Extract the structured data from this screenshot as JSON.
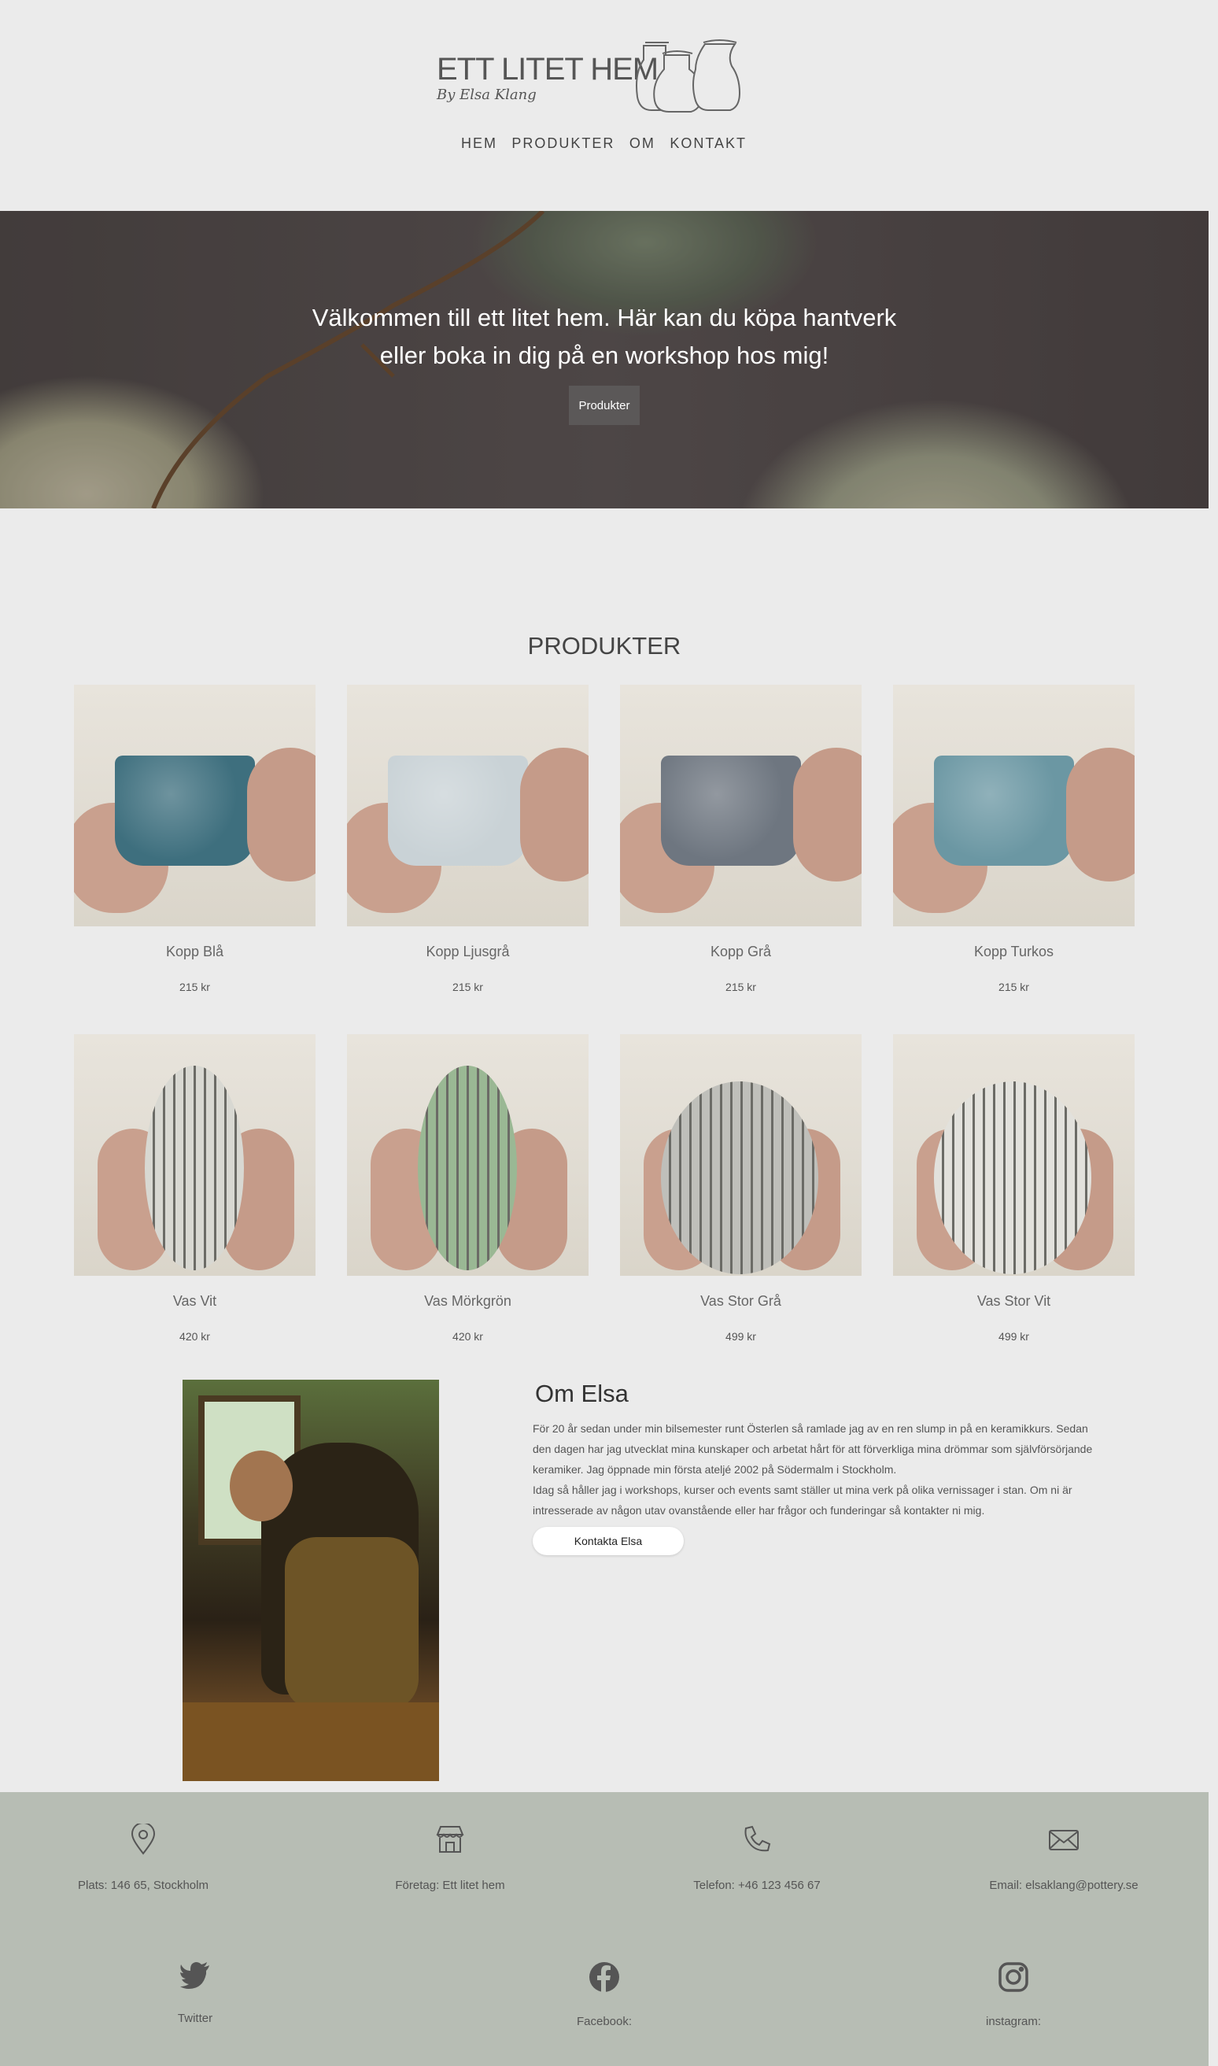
{
  "brand": {
    "title": "ETT LITET HEM",
    "subtitle": "By Elsa Klang"
  },
  "nav": {
    "items": [
      "HEM",
      "PRODUKTER",
      "OM",
      "KONTAKT"
    ]
  },
  "hero": {
    "text": "Välkommen till ett litet hem. Här kan du köpa hantverk eller boka in dig på en workshop hos mig!",
    "button": "Produkter"
  },
  "products": {
    "title": "PRODUKTER",
    "items": [
      {
        "name": "Kopp Blå",
        "price": "215 kr",
        "color": "#3e6f7e"
      },
      {
        "name": "Kopp Ljusgrå",
        "price": "215 kr",
        "color": "#c9d2d6"
      },
      {
        "name": "Kopp Grå",
        "price": "215 kr",
        "color": "#6e7680"
      },
      {
        "name": "Kopp Turkos",
        "price": "215 kr",
        "color": "#6b97a3"
      },
      {
        "name": "Vas Vit",
        "price": "420 kr",
        "color": "#d8d8d2"
      },
      {
        "name": "Vas Mörkgrön",
        "price": "420 kr",
        "color": "#9ab894"
      },
      {
        "name": "Vas Stor Grå",
        "price": "499 kr",
        "color": "#bfbfba"
      },
      {
        "name": "Vas Stor Vit",
        "price": "499 kr",
        "color": "#e2e1dc"
      }
    ]
  },
  "about": {
    "title": "Om Elsa",
    "paragraph1": "För 20 år sedan under min bilsemester runt Österlen så ramlade jag av en ren slump in på en keramikkurs. Sedan den dagen har jag utvecklat mina kunskaper och arbetat hårt för att förverkliga mina drömmar som självförsörjande keramiker. Jag öppnade min första ateljé 2002 på Södermalm i Stockholm.",
    "paragraph2": "Idag så håller jag i workshops, kurser och events samt ställer ut mina verk på olika vernissager i stan. Om ni är intresserade av någon utav ovanstående eller har frågor och funderingar så kontakter ni mig.",
    "button": "Kontakta Elsa"
  },
  "footer": {
    "info": [
      {
        "icon": "map-pin-icon",
        "text": "Plats: 146 65, Stockholm"
      },
      {
        "icon": "store-icon",
        "text": "Företag: Ett litet hem"
      },
      {
        "icon": "phone-icon",
        "text": "Telefon: +46 123 456 67"
      },
      {
        "icon": "mail-icon",
        "text": "Email: elsaklang@pottery.se"
      }
    ],
    "social": [
      {
        "icon": "twitter-icon",
        "text": "Twitter"
      },
      {
        "icon": "facebook-icon",
        "text": "Facebook:"
      },
      {
        "icon": "instagram-icon",
        "text": "instagram:"
      }
    ]
  }
}
